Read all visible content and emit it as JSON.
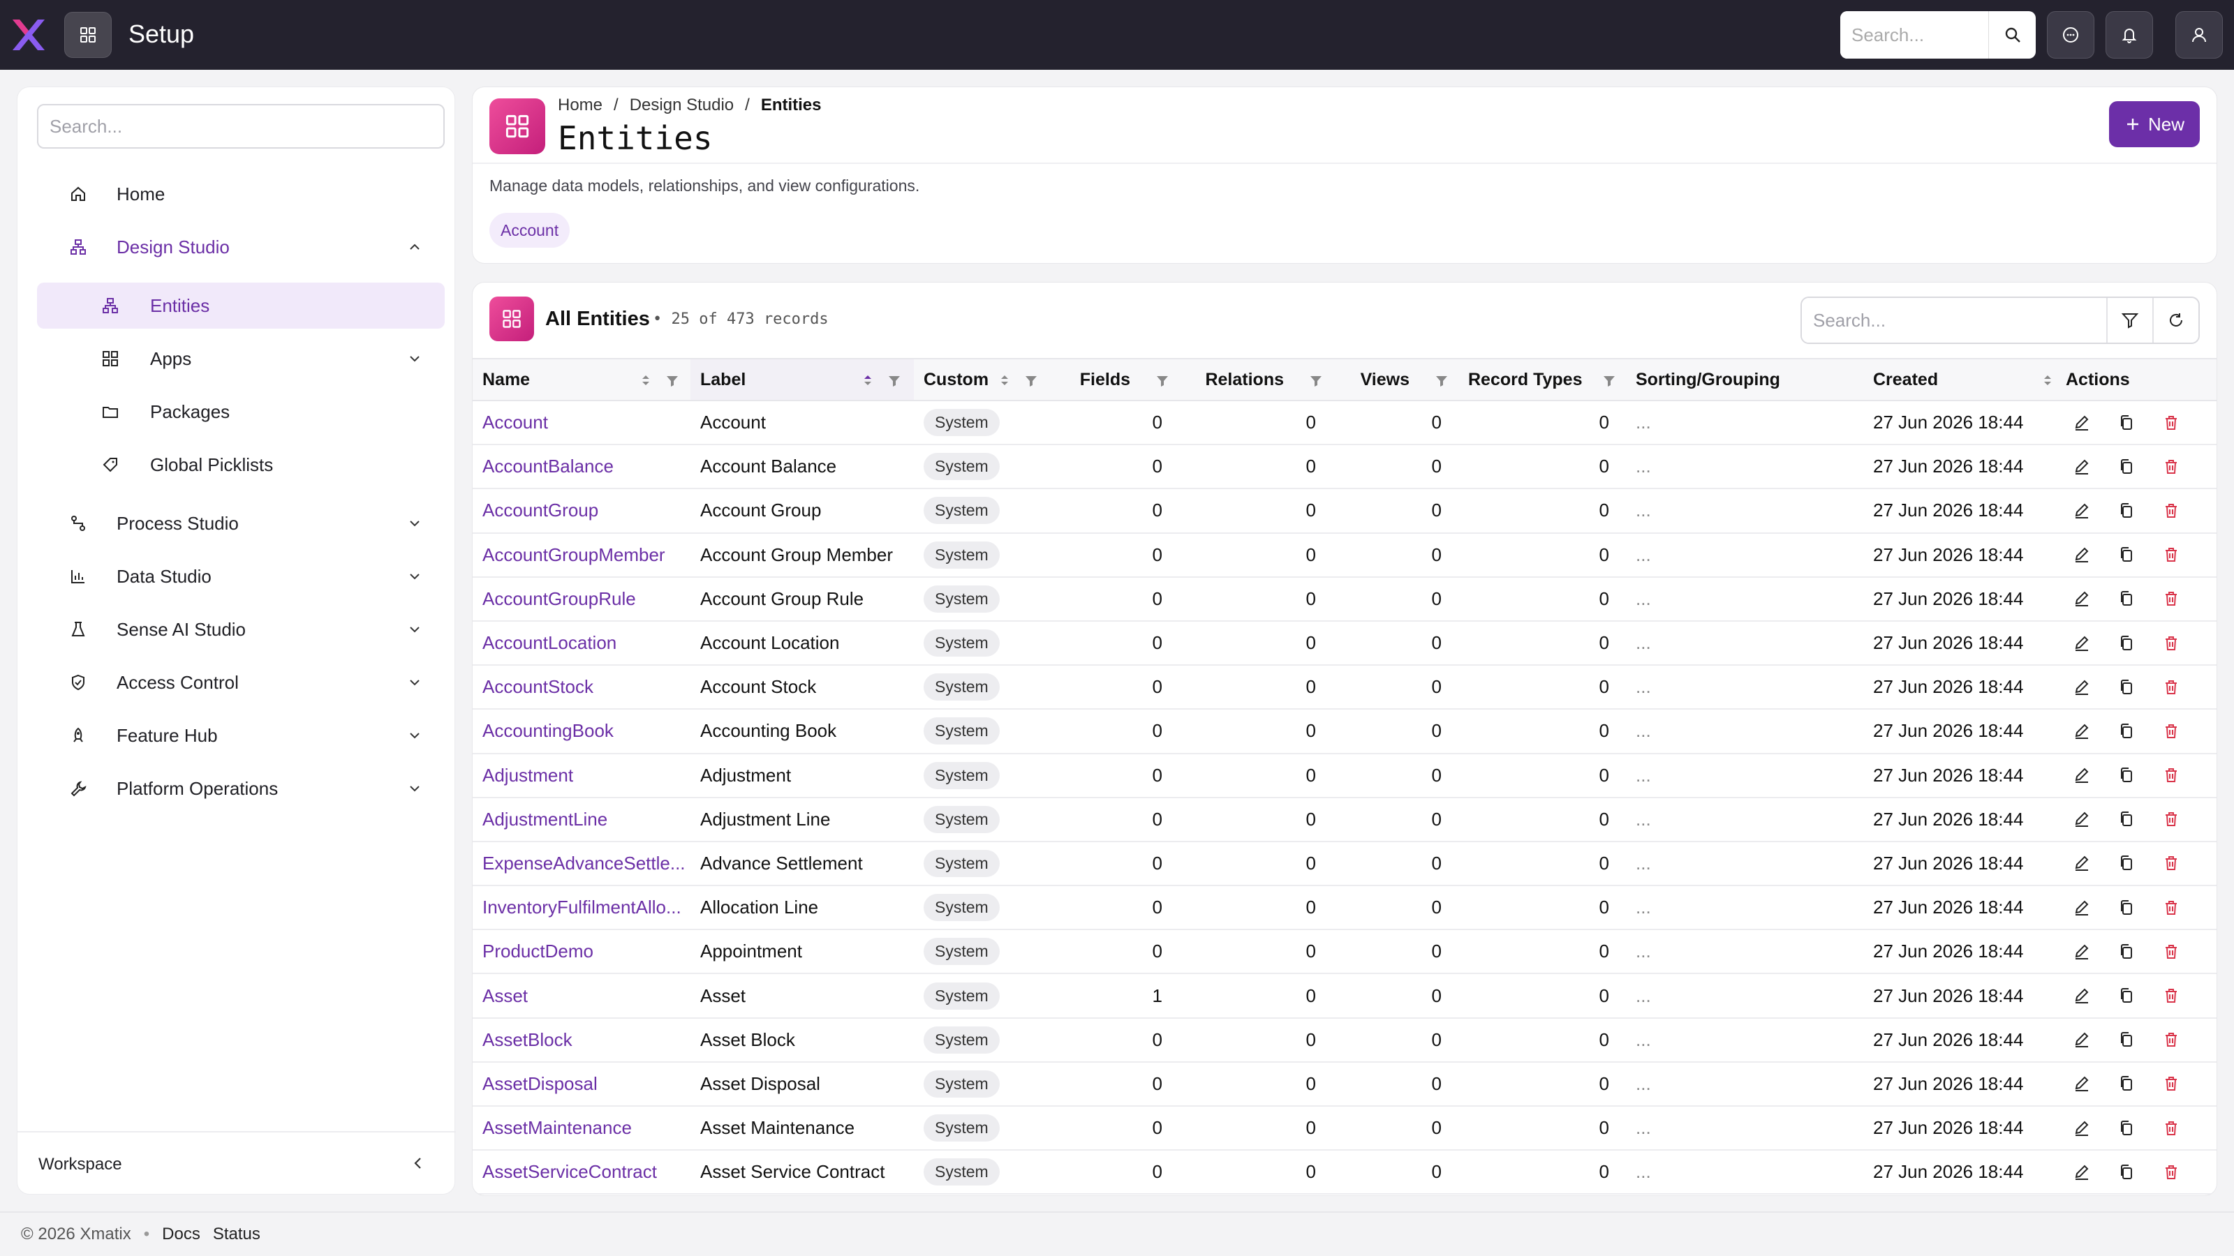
{
  "app": {
    "title": "Setup",
    "brand_color": "#6c2fa8",
    "accent_pink": "#e23b8f"
  },
  "topbar": {
    "search_placeholder": "Search...",
    "icons": [
      "apps-grid-icon",
      "search-icon",
      "chat-icon",
      "bell-icon",
      "user-icon"
    ]
  },
  "sidebar": {
    "search_placeholder": "Search...",
    "items": [
      {
        "label": "Home",
        "icon": "home-icon"
      },
      {
        "label": "Design Studio",
        "icon": "hierarchy-icon",
        "expanded": true
      },
      {
        "label": "Entities",
        "icon": "hierarchy-icon",
        "active": true
      },
      {
        "label": "Apps",
        "icon": "grid-icon"
      },
      {
        "label": "Packages",
        "icon": "folder-icon"
      },
      {
        "label": "Global Picklists",
        "icon": "tag-icon"
      },
      {
        "label": "Process Studio",
        "icon": "flow-icon"
      },
      {
        "label": "Data Studio",
        "icon": "bar-chart-icon"
      },
      {
        "label": "Sense AI Studio",
        "icon": "flask-icon"
      },
      {
        "label": "Access Control",
        "icon": "shield-icon"
      },
      {
        "label": "Feature Hub",
        "icon": "rocket-icon"
      },
      {
        "label": "Platform Operations",
        "icon": "wrench-icon"
      }
    ],
    "footer_label": "Workspace"
  },
  "header": {
    "breadcrumb": [
      "Home",
      "/",
      "Design Studio",
      "/",
      "Entities"
    ],
    "title": "Entities",
    "new_label": "New",
    "description": "Manage data models, relationships, and view configurations.",
    "chip": "Account"
  },
  "table": {
    "title": "All Entities",
    "count": "• 25 of 473 records",
    "search_placeholder": "Search...",
    "columns": [
      "Name",
      "Label",
      "Custom",
      "Fields",
      "Relations",
      "Views",
      "Record Types",
      "Sorting/Grouping",
      "Created",
      "Actions"
    ],
    "rows": [
      {
        "name": "Account",
        "label": "Account",
        "custom": "System",
        "fields": "0",
        "relations": "0",
        "views": "0",
        "record_types": "0",
        "sorting": "...",
        "created": "27 Jun 2026 18:44"
      },
      {
        "name": "AccountBalance",
        "label": "Account Balance",
        "custom": "System",
        "fields": "0",
        "relations": "0",
        "views": "0",
        "record_types": "0",
        "sorting": "...",
        "created": "27 Jun 2026 18:44"
      },
      {
        "name": "AccountGroup",
        "label": "Account Group",
        "custom": "System",
        "fields": "0",
        "relations": "0",
        "views": "0",
        "record_types": "0",
        "sorting": "...",
        "created": "27 Jun 2026 18:44"
      },
      {
        "name": "AccountGroupMember",
        "label": "Account Group Member",
        "custom": "System",
        "fields": "0",
        "relations": "0",
        "views": "0",
        "record_types": "0",
        "sorting": "...",
        "created": "27 Jun 2026 18:44"
      },
      {
        "name": "AccountGroupRule",
        "label": "Account Group Rule",
        "custom": "System",
        "fields": "0",
        "relations": "0",
        "views": "0",
        "record_types": "0",
        "sorting": "...",
        "created": "27 Jun 2026 18:44"
      },
      {
        "name": "AccountLocation",
        "label": "Account Location",
        "custom": "System",
        "fields": "0",
        "relations": "0",
        "views": "0",
        "record_types": "0",
        "sorting": "...",
        "created": "27 Jun 2026 18:44"
      },
      {
        "name": "AccountStock",
        "label": "Account Stock",
        "custom": "System",
        "fields": "0",
        "relations": "0",
        "views": "0",
        "record_types": "0",
        "sorting": "...",
        "created": "27 Jun 2026 18:44"
      },
      {
        "name": "AccountingBook",
        "label": "Accounting Book",
        "custom": "System",
        "fields": "0",
        "relations": "0",
        "views": "0",
        "record_types": "0",
        "sorting": "...",
        "created": "27 Jun 2026 18:44"
      },
      {
        "name": "Adjustment",
        "label": "Adjustment",
        "custom": "System",
        "fields": "0",
        "relations": "0",
        "views": "0",
        "record_types": "0",
        "sorting": "...",
        "created": "27 Jun 2026 18:44"
      },
      {
        "name": "AdjustmentLine",
        "label": "Adjustment Line",
        "custom": "System",
        "fields": "0",
        "relations": "0",
        "views": "0",
        "record_types": "0",
        "sorting": "...",
        "created": "27 Jun 2026 18:44"
      },
      {
        "name": "ExpenseAdvanceSettle...",
        "label": "Advance Settlement",
        "custom": "System",
        "fields": "0",
        "relations": "0",
        "views": "0",
        "record_types": "0",
        "sorting": "...",
        "created": "27 Jun 2026 18:44"
      },
      {
        "name": "InventoryFulfilmentAllo...",
        "label": "Allocation Line",
        "custom": "System",
        "fields": "0",
        "relations": "0",
        "views": "0",
        "record_types": "0",
        "sorting": "...",
        "created": "27 Jun 2026 18:44"
      },
      {
        "name": "ProductDemo",
        "label": "Appointment",
        "custom": "System",
        "fields": "0",
        "relations": "0",
        "views": "0",
        "record_types": "0",
        "sorting": "...",
        "created": "27 Jun 2026 18:44"
      },
      {
        "name": "Asset",
        "label": "Asset",
        "custom": "System",
        "fields": "1",
        "relations": "0",
        "views": "0",
        "record_types": "0",
        "sorting": "...",
        "created": "27 Jun 2026 18:44"
      },
      {
        "name": "AssetBlock",
        "label": "Asset Block",
        "custom": "System",
        "fields": "0",
        "relations": "0",
        "views": "0",
        "record_types": "0",
        "sorting": "...",
        "created": "27 Jun 2026 18:44"
      },
      {
        "name": "AssetDisposal",
        "label": "Asset Disposal",
        "custom": "System",
        "fields": "0",
        "relations": "0",
        "views": "0",
        "record_types": "0",
        "sorting": "...",
        "created": "27 Jun 2026 18:44"
      },
      {
        "name": "AssetMaintenance",
        "label": "Asset Maintenance",
        "custom": "System",
        "fields": "0",
        "relations": "0",
        "views": "0",
        "record_types": "0",
        "sorting": "...",
        "created": "27 Jun 2026 18:44"
      },
      {
        "name": "AssetServiceContract",
        "label": "Asset Service Contract",
        "custom": "System",
        "fields": "0",
        "relations": "0",
        "views": "0",
        "record_types": "0",
        "sorting": "...",
        "created": "27 Jun 2026 18:44"
      }
    ]
  },
  "footer": {
    "copyright": "© 2026 Xmatix",
    "bullet": "•",
    "links": [
      "Docs",
      "Status"
    ]
  }
}
